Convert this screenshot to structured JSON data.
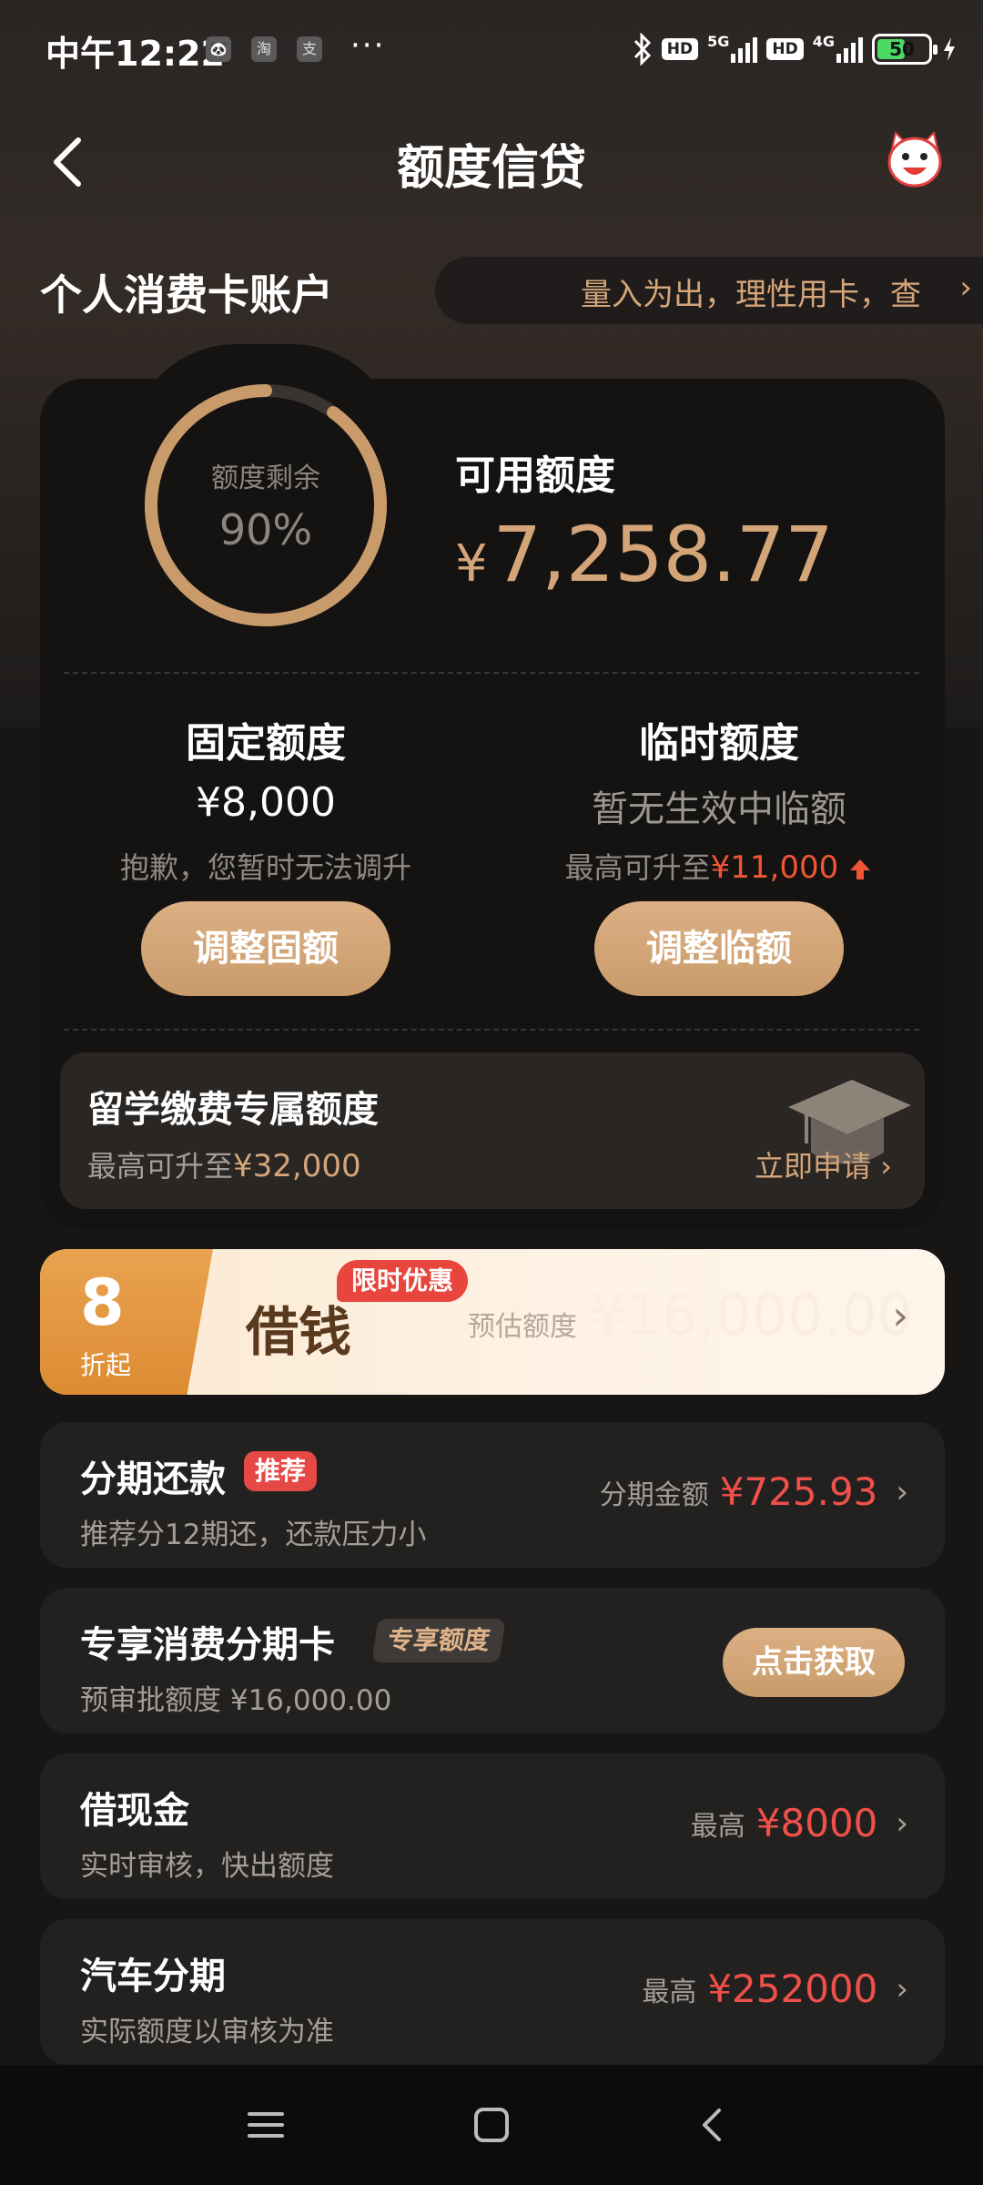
{
  "status_bar": {
    "time": "中午12:22",
    "app_icons": [
      "淘",
      "支"
    ],
    "dots": "···",
    "battery": "50",
    "network": [
      "5G",
      "4G"
    ],
    "hd": "HD"
  },
  "header": {
    "title": "额度信贷"
  },
  "account": {
    "title": "个人消费卡账户",
    "marquee": "量入为出，理性用卡，查"
  },
  "credit": {
    "ring_label": "额度剩余",
    "ring_value": "90%",
    "remaining_fraction": 0.9,
    "available_label": "可用额度",
    "available_currency": "¥",
    "available_amount": "7,258.77"
  },
  "fixed": {
    "title": "固定额度",
    "value": "¥8,000",
    "note": "抱歉，您暂时无法调升",
    "button": "调整固额"
  },
  "temporary": {
    "title": "临时额度",
    "value": "暂无生效中临额",
    "note_prefix": "最高可升至",
    "note_amount": "¥11,000",
    "button": "调整临额"
  },
  "study": {
    "title": "留学缴费专属额度",
    "note_prefix": "最高可升至",
    "note_amount": "¥32,000",
    "link": "立即申请 ›"
  },
  "promo": {
    "discount": "8",
    "discount_unit": "折起",
    "name": "借钱",
    "tag": "限时优惠",
    "estimate_label": "预估额度",
    "estimate_amount": "¥16,000.00"
  },
  "rows": [
    {
      "title": "分期还款",
      "tag": "推荐",
      "subtitle": "推荐分12期还，还款压力小",
      "right_label": "分期金额",
      "right_amount": "¥725.93"
    },
    {
      "title": "专享消费分期卡",
      "tag": "专享额度",
      "subtitle": "预审批额度 ¥16,000.00",
      "button": "点击获取"
    },
    {
      "title": "借现金",
      "subtitle": "实时审核，快出额度",
      "right_label": "最高",
      "right_amount": "¥8000"
    },
    {
      "title": "汽车分期",
      "subtitle": "实际额度以审核为准",
      "right_label": "最高",
      "right_amount": "¥252000"
    }
  ],
  "colors": {
    "accent_gold": "#d5a57a",
    "accent_red": "#f0504a",
    "background": "#171615"
  }
}
